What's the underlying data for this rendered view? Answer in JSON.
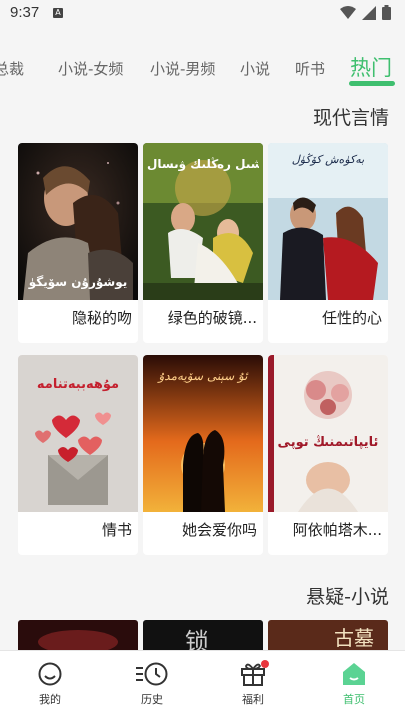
{
  "status": {
    "time": "9:37",
    "notice_icon": "A"
  },
  "tabs": [
    {
      "label": "总裁",
      "active": false
    },
    {
      "label": "小说-女频",
      "active": false
    },
    {
      "label": "小说-男频",
      "active": false
    },
    {
      "label": "小说",
      "active": false
    },
    {
      "label": "听书",
      "active": false
    },
    {
      "label": "热门",
      "active": true
    }
  ],
  "sections": [
    {
      "title": "现代言情",
      "books": [
        {
          "title": "任性的心",
          "cover_text": "بەكۈەش كۆڭۈل"
        },
        {
          "title": "绿色的破镜...",
          "cover_text": "يېشىل رەڭلىك ۋىسال"
        },
        {
          "title": "隐秘的吻",
          "cover_text": "يوشۇرۇن سۆيگۈ"
        },
        {
          "title": "阿依帕塔木...",
          "cover_text": "ئايپاتىمنىڭ توپى"
        },
        {
          "title": "她会爱你吗",
          "cover_text": "ئۇ سېنى سۆيەمدۇ"
        },
        {
          "title": "情书",
          "cover_text": "مۇھەببەتنامە"
        }
      ]
    },
    {
      "title": "悬疑-小说",
      "peek_texts": [
        "古墓",
        "锁"
      ]
    }
  ],
  "bottom_nav": [
    {
      "label": "首页",
      "icon": "home-icon",
      "active": true
    },
    {
      "label": "福利",
      "icon": "gift-icon",
      "active": false,
      "badge": true
    },
    {
      "label": "历史",
      "icon": "history-icon",
      "active": false
    },
    {
      "label": "我的",
      "icon": "profile-icon",
      "active": false
    }
  ],
  "colors": {
    "accent": "#3fbf6f",
    "badge": "#e8353d",
    "background": "#f5f5f5"
  }
}
